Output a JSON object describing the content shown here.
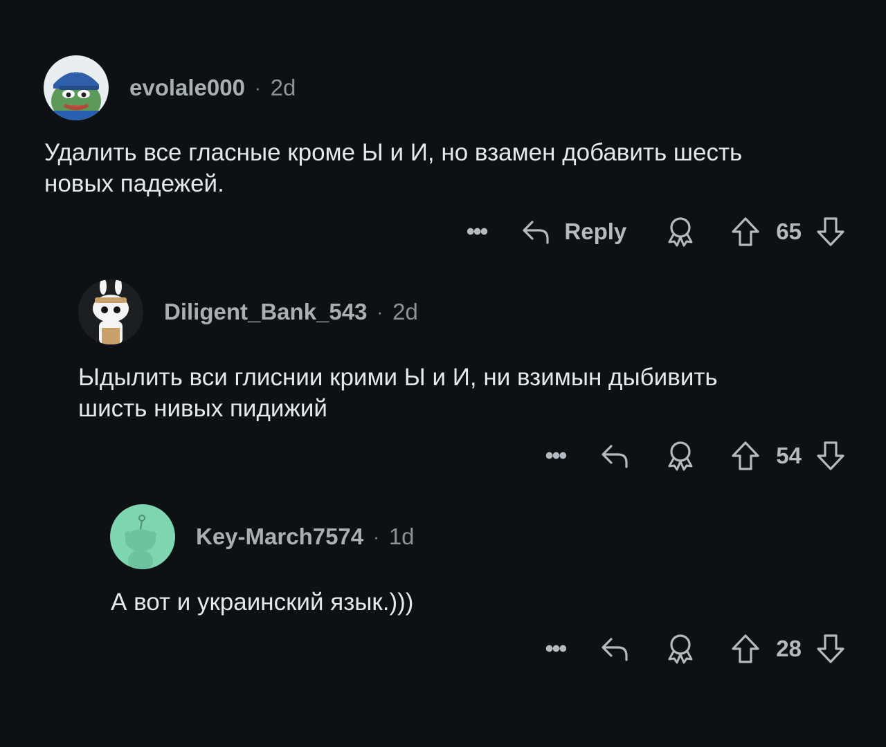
{
  "comments": [
    {
      "username": "evolale000",
      "age": "2d",
      "text": "Удалить все гласные кроме Ы и И, но взамен добавить шесть\nновых падежей.",
      "reply_label": "Reply",
      "votes": "65",
      "avatar": "pepe-with-cap",
      "more_icon": "more-icon"
    },
    {
      "username": "Diligent_Bank_543",
      "age": "2d",
      "text": "Ыдылить вси глиснии крими Ы и И, ни взимын дыбивить\nшисть нивых пидижий",
      "votes": "54",
      "avatar": "snoo-bunny"
    },
    {
      "username": "Key-March7574",
      "age": "1d",
      "text": "А вот и украинский язык.)))",
      "votes": "28",
      "avatar": "snoo-default"
    }
  ],
  "separator": "·",
  "more_glyph": "•••",
  "colors": {
    "background": "#0e1114",
    "text": "#e6e8ea",
    "meta": "#8a9399",
    "avatar3_bg": "#7ed6b0"
  }
}
